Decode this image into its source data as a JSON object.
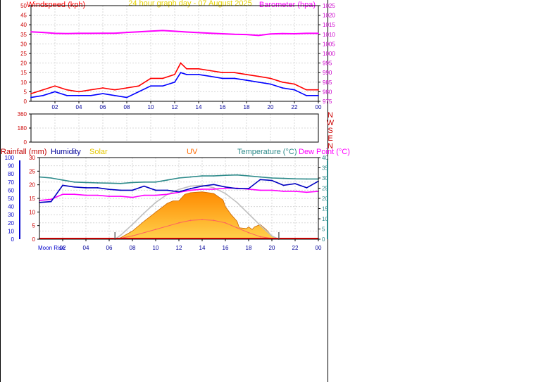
{
  "title": "24 hour graph day - 07 August 2025",
  "colors": {
    "wind_speed": "#ff0000",
    "wind_avg": "#0000ff",
    "barometer": "#ff00ff",
    "humidity": "#0000c0",
    "temperature": "#2e8b8b",
    "dewpoint": "#ff00ff",
    "rainfall": "#ff0000",
    "solar_fill": "#ffb000",
    "solar_edge": "#cc6600",
    "solar_max": "#c0c0c0",
    "uv": "#ff6060",
    "axis_blue": "#0000cc",
    "axis_teal": "#2e8b8b",
    "grid": "#d8d8d8"
  },
  "chart_data": [
    {
      "type": "line",
      "name": "wind-barometer",
      "x_ticks": [
        "02",
        "04",
        "06",
        "08",
        "10",
        "12",
        "14",
        "16",
        "18",
        "20",
        "22",
        "00"
      ],
      "left_axis": {
        "label": "Windspeed (kph)",
        "range": [
          0,
          50
        ],
        "ticks": [
          "0",
          "5",
          "10",
          "15",
          "20",
          "25",
          "30",
          "35",
          "40",
          "45",
          "50"
        ]
      },
      "right_axis": {
        "label": "Barometer (hpa)",
        "range": [
          975,
          1025
        ],
        "ticks": [
          "975",
          "980",
          "985",
          "990",
          "995",
          "1000",
          "1005",
          "1010",
          "1015",
          "1020",
          "1025"
        ]
      },
      "x_range": [
        0,
        24
      ],
      "series": [
        {
          "key": "barometer",
          "axis": "right",
          "x": [
            0,
            1,
            2,
            3,
            4,
            5,
            6,
            7,
            8,
            9,
            10,
            11,
            12,
            13,
            14,
            15,
            16,
            17,
            18,
            19,
            20,
            21,
            22,
            23,
            24
          ],
          "values": [
            1011.3,
            1011,
            1010.5,
            1010.4,
            1010.5,
            1010.5,
            1010.6,
            1010.6,
            1011,
            1011.3,
            1011.7,
            1012,
            1011.6,
            1011.2,
            1010.9,
            1010.6,
            1010.3,
            1010,
            1009.9,
            1009.4,
            1010.2,
            1010.4,
            1010.3,
            1010.5,
            1010.5
          ]
        },
        {
          "key": "wind_speed",
          "axis": "left",
          "x": [
            0,
            1,
            2,
            3,
            4,
            5,
            6,
            7,
            8,
            9,
            10,
            11,
            12,
            12.5,
            13,
            14,
            15,
            16,
            17,
            18,
            19,
            20,
            21,
            22,
            23,
            24
          ],
          "values": [
            4,
            6,
            8,
            6,
            5,
            6,
            7,
            6,
            7,
            8,
            12,
            12,
            14,
            20,
            17,
            17,
            16,
            15,
            15,
            14,
            13,
            12,
            10,
            9,
            6,
            6
          ]
        },
        {
          "key": "wind_avg",
          "axis": "left",
          "x": [
            0,
            1,
            2,
            3,
            4,
            5,
            6,
            7,
            8,
            9,
            10,
            11,
            12,
            12.5,
            13,
            14,
            15,
            16,
            17,
            18,
            19,
            20,
            21,
            22,
            23,
            24
          ],
          "values": [
            2,
            3,
            5,
            3,
            3,
            3,
            4,
            3,
            2,
            5,
            8,
            8,
            10,
            15,
            14,
            14,
            13,
            12,
            12,
            11,
            10,
            9,
            7,
            6,
            3,
            3
          ]
        }
      ]
    },
    {
      "type": "line",
      "name": "wind-direction",
      "y_ticks": [
        "0",
        "180",
        "360"
      ],
      "compass": [
        "N",
        "W",
        "S",
        "E",
        "N"
      ],
      "series": []
    },
    {
      "type": "line",
      "name": "temperature-humidity-solar",
      "x_ticks": [
        "02",
        "04",
        "06",
        "08",
        "10",
        "12",
        "14",
        "16",
        "18",
        "20",
        "22",
        "00"
      ],
      "x_range": [
        0,
        24
      ],
      "legend": [
        "Rainfall (mm)",
        "Humidity",
        "Solar",
        "UV",
        "Temperature (°C)",
        "Dew Point (°C)"
      ],
      "humidity_axis": {
        "range": [
          0,
          100
        ],
        "ticks": [
          "0",
          "10",
          "20",
          "30",
          "40",
          "50",
          "60",
          "70",
          "80",
          "90",
          "100"
        ]
      },
      "rain_axis": {
        "range": [
          0,
          30
        ],
        "ticks": [
          "0",
          "5",
          "10",
          "15",
          "20",
          "25",
          "30"
        ]
      },
      "temp_axis": {
        "range": [
          0,
          40
        ],
        "ticks": [
          "0",
          "5",
          "10",
          "15",
          "20",
          "25",
          "30",
          "35",
          "40"
        ]
      },
      "sunrise_hour": 6.5,
      "sunset_hour": 20.6,
      "moon_label": "Moon Rise",
      "series": [
        {
          "key": "humidity",
          "axis": "humidity",
          "x": [
            0,
            1,
            2,
            3,
            4,
            5,
            6,
            7,
            8,
            9,
            10,
            11,
            12,
            13,
            14,
            15,
            16,
            17,
            18,
            19,
            20,
            21,
            22,
            23,
            24
          ],
          "values": [
            45,
            46,
            66,
            64,
            63,
            63,
            61,
            60,
            60,
            65,
            60,
            60,
            58,
            62,
            65,
            67,
            64,
            62,
            62,
            73,
            72,
            66,
            68,
            63,
            71
          ]
        },
        {
          "key": "temperature",
          "axis": "temp",
          "x": [
            0,
            1,
            2,
            3,
            4,
            5,
            6,
            7,
            8,
            9,
            10,
            11,
            12,
            13,
            14,
            15,
            16,
            17,
            18,
            19,
            20,
            21,
            22,
            23,
            24
          ],
          "values": [
            30.5,
            30,
            29,
            28,
            27.8,
            27.6,
            27.5,
            27.3,
            27.8,
            28,
            28,
            29,
            30,
            30.5,
            31,
            31,
            31.3,
            31.5,
            31,
            30.5,
            30,
            29.8,
            29.6,
            29.5,
            29.5
          ]
        },
        {
          "key": "dewpoint",
          "axis": "temp",
          "x": [
            0,
            1,
            2,
            3,
            4,
            5,
            6,
            7,
            8,
            9,
            10,
            11,
            12,
            13,
            14,
            15,
            16,
            17,
            18,
            19,
            20,
            21,
            22,
            23,
            24
          ],
          "values": [
            19,
            19.5,
            22,
            22,
            21.5,
            21.5,
            21,
            21,
            20.5,
            21.5,
            21.5,
            22,
            23,
            24,
            24.5,
            24.5,
            25,
            25,
            24.5,
            24,
            24,
            23.5,
            23.5,
            23,
            23.5
          ]
        },
        {
          "key": "solar",
          "axis": "humidity",
          "fill": true,
          "x": [
            6.5,
            7,
            8,
            9,
            10,
            11,
            11.5,
            12,
            12.5,
            13,
            14,
            15,
            15.8,
            16,
            16.5,
            17,
            17.2,
            17.8,
            18,
            18.3,
            18.5,
            19,
            19.5,
            20,
            20.6
          ],
          "values": [
            0,
            2,
            10,
            22,
            33,
            44,
            47,
            47,
            55,
            57,
            58,
            56,
            48,
            40,
            30,
            22,
            14,
            13,
            15,
            12,
            15,
            18,
            12,
            4,
            0
          ]
        },
        {
          "key": "solar_max",
          "axis": "humidity",
          "x": [
            6.5,
            7,
            8,
            9,
            10,
            11,
            12,
            13,
            14,
            15,
            16,
            17,
            18,
            19,
            20,
            20.6
          ],
          "values": [
            0,
            5,
            18,
            32,
            45,
            55,
            61,
            65,
            66,
            63,
            56,
            45,
            31,
            17,
            4,
            0
          ]
        },
        {
          "key": "uv",
          "axis": "humidity",
          "x": [
            6.5,
            8,
            10,
            12,
            13,
            14,
            15,
            16,
            17,
            18,
            19,
            20,
            20.6
          ],
          "values": [
            0,
            4,
            12,
            20,
            23,
            24,
            23,
            20,
            14,
            8,
            3,
            1,
            0
          ]
        }
      ]
    }
  ]
}
